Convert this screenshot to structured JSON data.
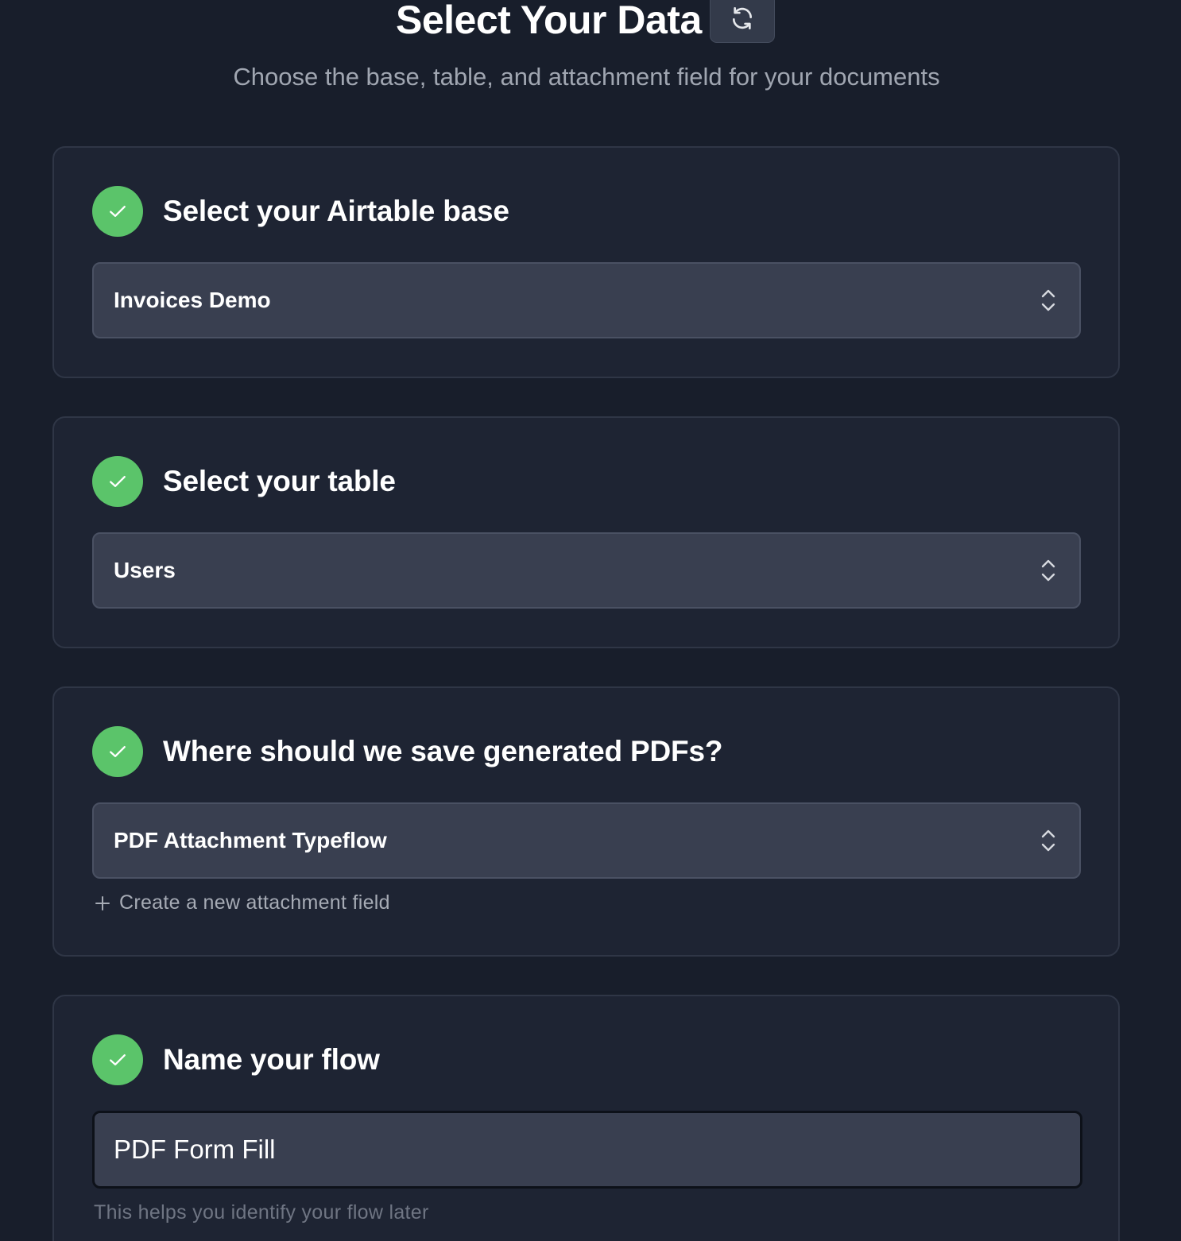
{
  "header": {
    "title": "Select Your Data",
    "subtitle": "Choose the base, table, and attachment field for your documents",
    "refresh_icon": "refresh-icon"
  },
  "steps": [
    {
      "title": "Select your Airtable base",
      "status": "complete",
      "selected": "Invoices Demo"
    },
    {
      "title": "Select your table",
      "status": "complete",
      "selected": "Users"
    },
    {
      "title": "Where should we save generated PDFs?",
      "status": "complete",
      "selected": "PDF Attachment Typeflow",
      "create_link": "Create a new attachment field"
    },
    {
      "title": "Name your flow",
      "status": "complete",
      "input_value": "PDF Form Fill",
      "helper": "This helps you identify your flow later"
    }
  ],
  "colors": {
    "background": "#181e2b",
    "card": "#1e2433",
    "success": "#5bc46a",
    "field": "#393f50"
  }
}
